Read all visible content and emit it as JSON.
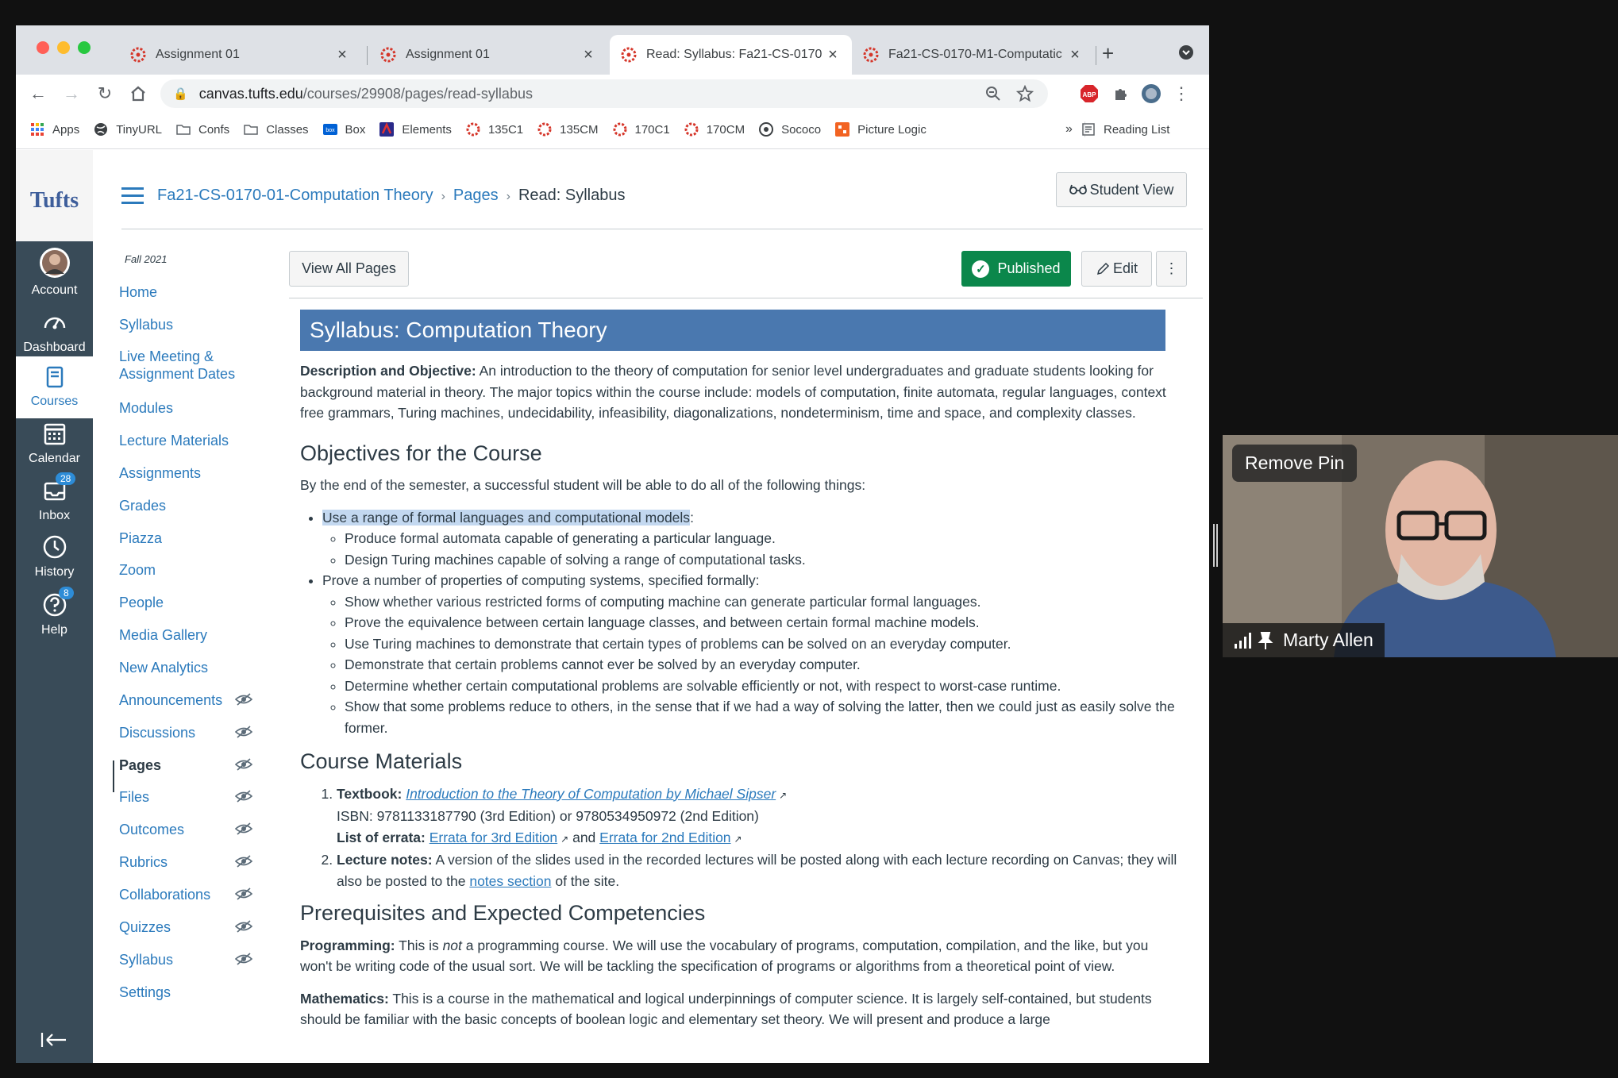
{
  "browser": {
    "tabs": [
      {
        "title": "Assignment 01",
        "active": false
      },
      {
        "title": "Assignment 01",
        "active": false
      },
      {
        "title": "Read: Syllabus: Fa21-CS-0170",
        "active": true
      },
      {
        "title": "Fa21-CS-0170-M1-Computatic",
        "active": false
      }
    ],
    "url_host": "canvas.tufts.edu",
    "url_path": "/courses/29908/pages/read-syllabus",
    "bookmarks": [
      "Apps",
      "TinyURL",
      "Confs",
      "Classes",
      "Box",
      "Elements",
      "135C1",
      "135CM",
      "170C1",
      "170CM",
      "Sococo",
      "Picture Logic"
    ],
    "bookmarks_overflow": "»",
    "reading_list": "Reading List",
    "extension_abp": "ABP"
  },
  "global_nav": {
    "logo": "Tufts",
    "items": [
      {
        "label": "Account",
        "icon": "avatar"
      },
      {
        "label": "Dashboard",
        "icon": "dashboard-icon"
      },
      {
        "label": "Courses",
        "icon": "courses-icon"
      },
      {
        "label": "Calendar",
        "icon": "calendar-icon"
      },
      {
        "label": "Inbox",
        "icon": "inbox-icon",
        "badge": "28"
      },
      {
        "label": "History",
        "icon": "history-icon"
      },
      {
        "label": "Help",
        "icon": "help-icon",
        "badge": "8"
      }
    ]
  },
  "course_nav": {
    "term": "Fall 2021",
    "items": [
      {
        "label": "Home",
        "hidden": false
      },
      {
        "label": "Syllabus",
        "hidden": false
      },
      {
        "label": "Live Meeting & Assignment Dates",
        "hidden": false
      },
      {
        "label": "Modules",
        "hidden": false
      },
      {
        "label": "Lecture Materials",
        "hidden": false
      },
      {
        "label": "Assignments",
        "hidden": false
      },
      {
        "label": "Grades",
        "hidden": false
      },
      {
        "label": "Piazza",
        "hidden": false
      },
      {
        "label": "Zoom",
        "hidden": false
      },
      {
        "label": "People",
        "hidden": false
      },
      {
        "label": "Media Gallery",
        "hidden": false
      },
      {
        "label": "New Analytics",
        "hidden": false
      },
      {
        "label": "Announcements",
        "hidden": true
      },
      {
        "label": "Discussions",
        "hidden": true
      },
      {
        "label": "Pages",
        "hidden": true,
        "active": true
      },
      {
        "label": "Files",
        "hidden": true
      },
      {
        "label": "Outcomes",
        "hidden": true
      },
      {
        "label": "Rubrics",
        "hidden": true
      },
      {
        "label": "Collaborations",
        "hidden": true
      },
      {
        "label": "Quizzes",
        "hidden": true
      },
      {
        "label": "Syllabus",
        "hidden": true
      },
      {
        "label": "Settings",
        "hidden": false
      }
    ]
  },
  "header": {
    "breadcrumbs": [
      "Fa21-CS-0170-01-Computation Theory",
      "Pages",
      "Read: Syllabus"
    ],
    "breadcrumb_sep": "›",
    "student_view": "Student View"
  },
  "page_actions": {
    "view_all": "View All Pages",
    "published": "Published",
    "edit": "Edit",
    "more": "⋮"
  },
  "page": {
    "banner": "Syllabus: Computation Theory",
    "desc_label": "Description and Objective:",
    "desc_text": " An introduction to the theory of computation for senior level undergraduates and graduate students looking for background material in theory. The major topics within the course include: models of computation, finite automata, regular languages, context free grammars, Turing machines, undecidability, infeasibility, diagonalizations, nondeterminism, time and space, and complexity classes.",
    "objectives_heading": "Objectives for the Course",
    "objectives_intro": "By the end of the semester, a successful student will be able to do all of the following things:",
    "obj1": "Use a range of formal languages and computational models",
    "obj1_colon": ":",
    "obj1_sub": [
      "Produce formal automata capable of generating a particular language.",
      "Design Turing machines capable of solving a range of computational tasks."
    ],
    "obj2": "Prove a number of properties of computing systems, specified formally:",
    "obj2_sub": [
      "Show whether various restricted forms of computing machine can generate particular formal languages.",
      "Prove the equivalence between certain language classes, and between certain formal machine models.",
      "Use Turing machines to demonstrate that certain types of problems can be solved on an everyday computer.",
      "Demonstrate that certain problems cannot ever be solved by an everyday computer.",
      "Determine whether certain computational problems are solvable efficiently or not, with respect to worst-case runtime.",
      "Show that some problems reduce to others, in the sense that if we had a way of solving the latter, then we could just as easily solve the former."
    ],
    "materials_heading": "Course Materials",
    "textbook_label": "Textbook:",
    "textbook_link": "Introduction to the Theory of Computation by Michael Sipser",
    "isbn": "ISBN: 9781133187790 (3rd Edition) or 9780534950972 (2nd Edition)",
    "errata_label": "List of errata:",
    "errata3": "Errata for 3rd Edition",
    "errata_and": " and ",
    "errata2": "Errata for 2nd Edition",
    "notes_label": "Lecture notes:",
    "notes_text": " A version of the slides used in the recorded lectures will be posted along with each lecture recording on Canvas; they will also be posted to the ",
    "notes_link": "notes section",
    "notes_tail": " of the site.",
    "prereq_heading": "Prerequisites and Expected Competencies",
    "prog_label": "Programming:",
    "prog_a": " This is ",
    "prog_not": "not",
    "prog_b": " a programming course.  We will use the vocabulary of programs, computation, compilation, and the like, but you won't be writing code of the usual sort.  We will be tackling the specification of programs or algorithms from a theoretical point of view.",
    "math_label": "Mathematics:",
    "math_text": " This is a course in the mathematical and logical underpinnings of computer science.  It is largely self-contained, but students should be familiar with the basic concepts of boolean logic and elementary set theory.  We will present and produce a large"
  },
  "video": {
    "remove_pin": "Remove Pin",
    "participant": "Marty Allen"
  },
  "colors": {
    "canvas_nav": "#394b58",
    "link": "#2b7abc",
    "banner": "#4a78af",
    "published": "#0b874b"
  }
}
